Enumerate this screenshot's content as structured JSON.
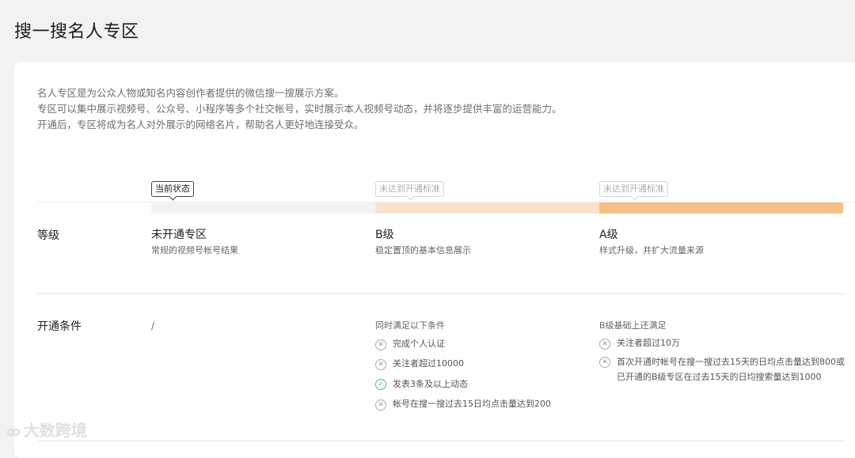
{
  "page": {
    "title": "搜一搜名人专区"
  },
  "intro": {
    "lines": [
      "名人专区是为公众人物或知名内容创作者提供的微信搜一搜展示方案。",
      "专区可以集中展示视频号、公众号、小程序等多个社交帐号，实时展示本人视频号动态，并将逐步提供丰富的运营能力。",
      "开通后，专区将成为名人对外展示的网络名片，帮助名人更好地连接受众。"
    ]
  },
  "levels": {
    "row_label": "等级",
    "tiers": [
      {
        "status": "当前状态",
        "name": "未开通专区",
        "desc": "常规的视频号帐号结果",
        "bar_color": "#f3f3f3"
      },
      {
        "status": "未达到开通标准",
        "name": "B级",
        "desc": "稳定置顶的基本信息展示",
        "bar_color": "#fbe3cb"
      },
      {
        "status": "未达到开通标准",
        "name": "A级",
        "desc": "样式升级，并扩大流量来源",
        "bar_color": "#f5bf86"
      }
    ]
  },
  "conditions": {
    "row_label": "开通条件",
    "none_value": "/",
    "b_tier": {
      "heading": "同时满足以下条件",
      "items": [
        {
          "text": "完成个人认证",
          "met": false,
          "icon": "x-circle-icon"
        },
        {
          "text": "关注者超过10000",
          "met": false,
          "icon": "x-circle-icon"
        },
        {
          "text": "发表3条及以上动态",
          "met": true,
          "icon": "check-circle-icon"
        },
        {
          "text": "帐号在搜一搜过去15日均点击量达到200",
          "met": false,
          "icon": "x-circle-icon"
        }
      ]
    },
    "a_tier": {
      "heading": "B级基础上还满足",
      "items": [
        {
          "text": "关注者超过10万",
          "met": false,
          "icon": "x-circle-icon"
        },
        {
          "text": "首次开通时帐号在搜一搜过去15天的日均点击量达到800或",
          "text2": "已开通的B级专区在过去15天的日均搜索量达到1000",
          "met": false,
          "icon": "x-circle-icon"
        }
      ]
    }
  },
  "watermark": {
    "text": "大数跨境"
  }
}
